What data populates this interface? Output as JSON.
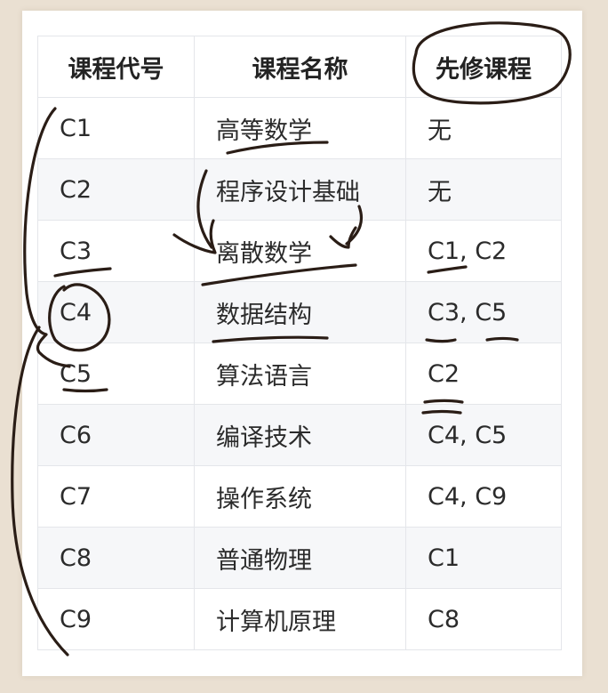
{
  "table": {
    "headers": [
      "课程代号",
      "课程名称",
      "先修课程"
    ],
    "rows": [
      [
        "C1",
        "高等数学",
        "无"
      ],
      [
        "C2",
        "程序设计基础",
        "无"
      ],
      [
        "C3",
        "离散数学",
        "C1, C2"
      ],
      [
        "C4",
        "数据结构",
        "C3, C5"
      ],
      [
        "C5",
        "算法语言",
        "C2"
      ],
      [
        "C6",
        "编译技术",
        "C4, C5"
      ],
      [
        "C7",
        "操作系统",
        "C4, C9"
      ],
      [
        "C8",
        "普通物理",
        "C1"
      ],
      [
        "C9",
        "计算机原理",
        "C8"
      ]
    ]
  },
  "colors": {
    "backdrop": "#eae0d2",
    "paper": "#ffffff",
    "stripe": "#f6f7f9",
    "grid": "#e4e6ea",
    "ink": "#2a1d16"
  }
}
